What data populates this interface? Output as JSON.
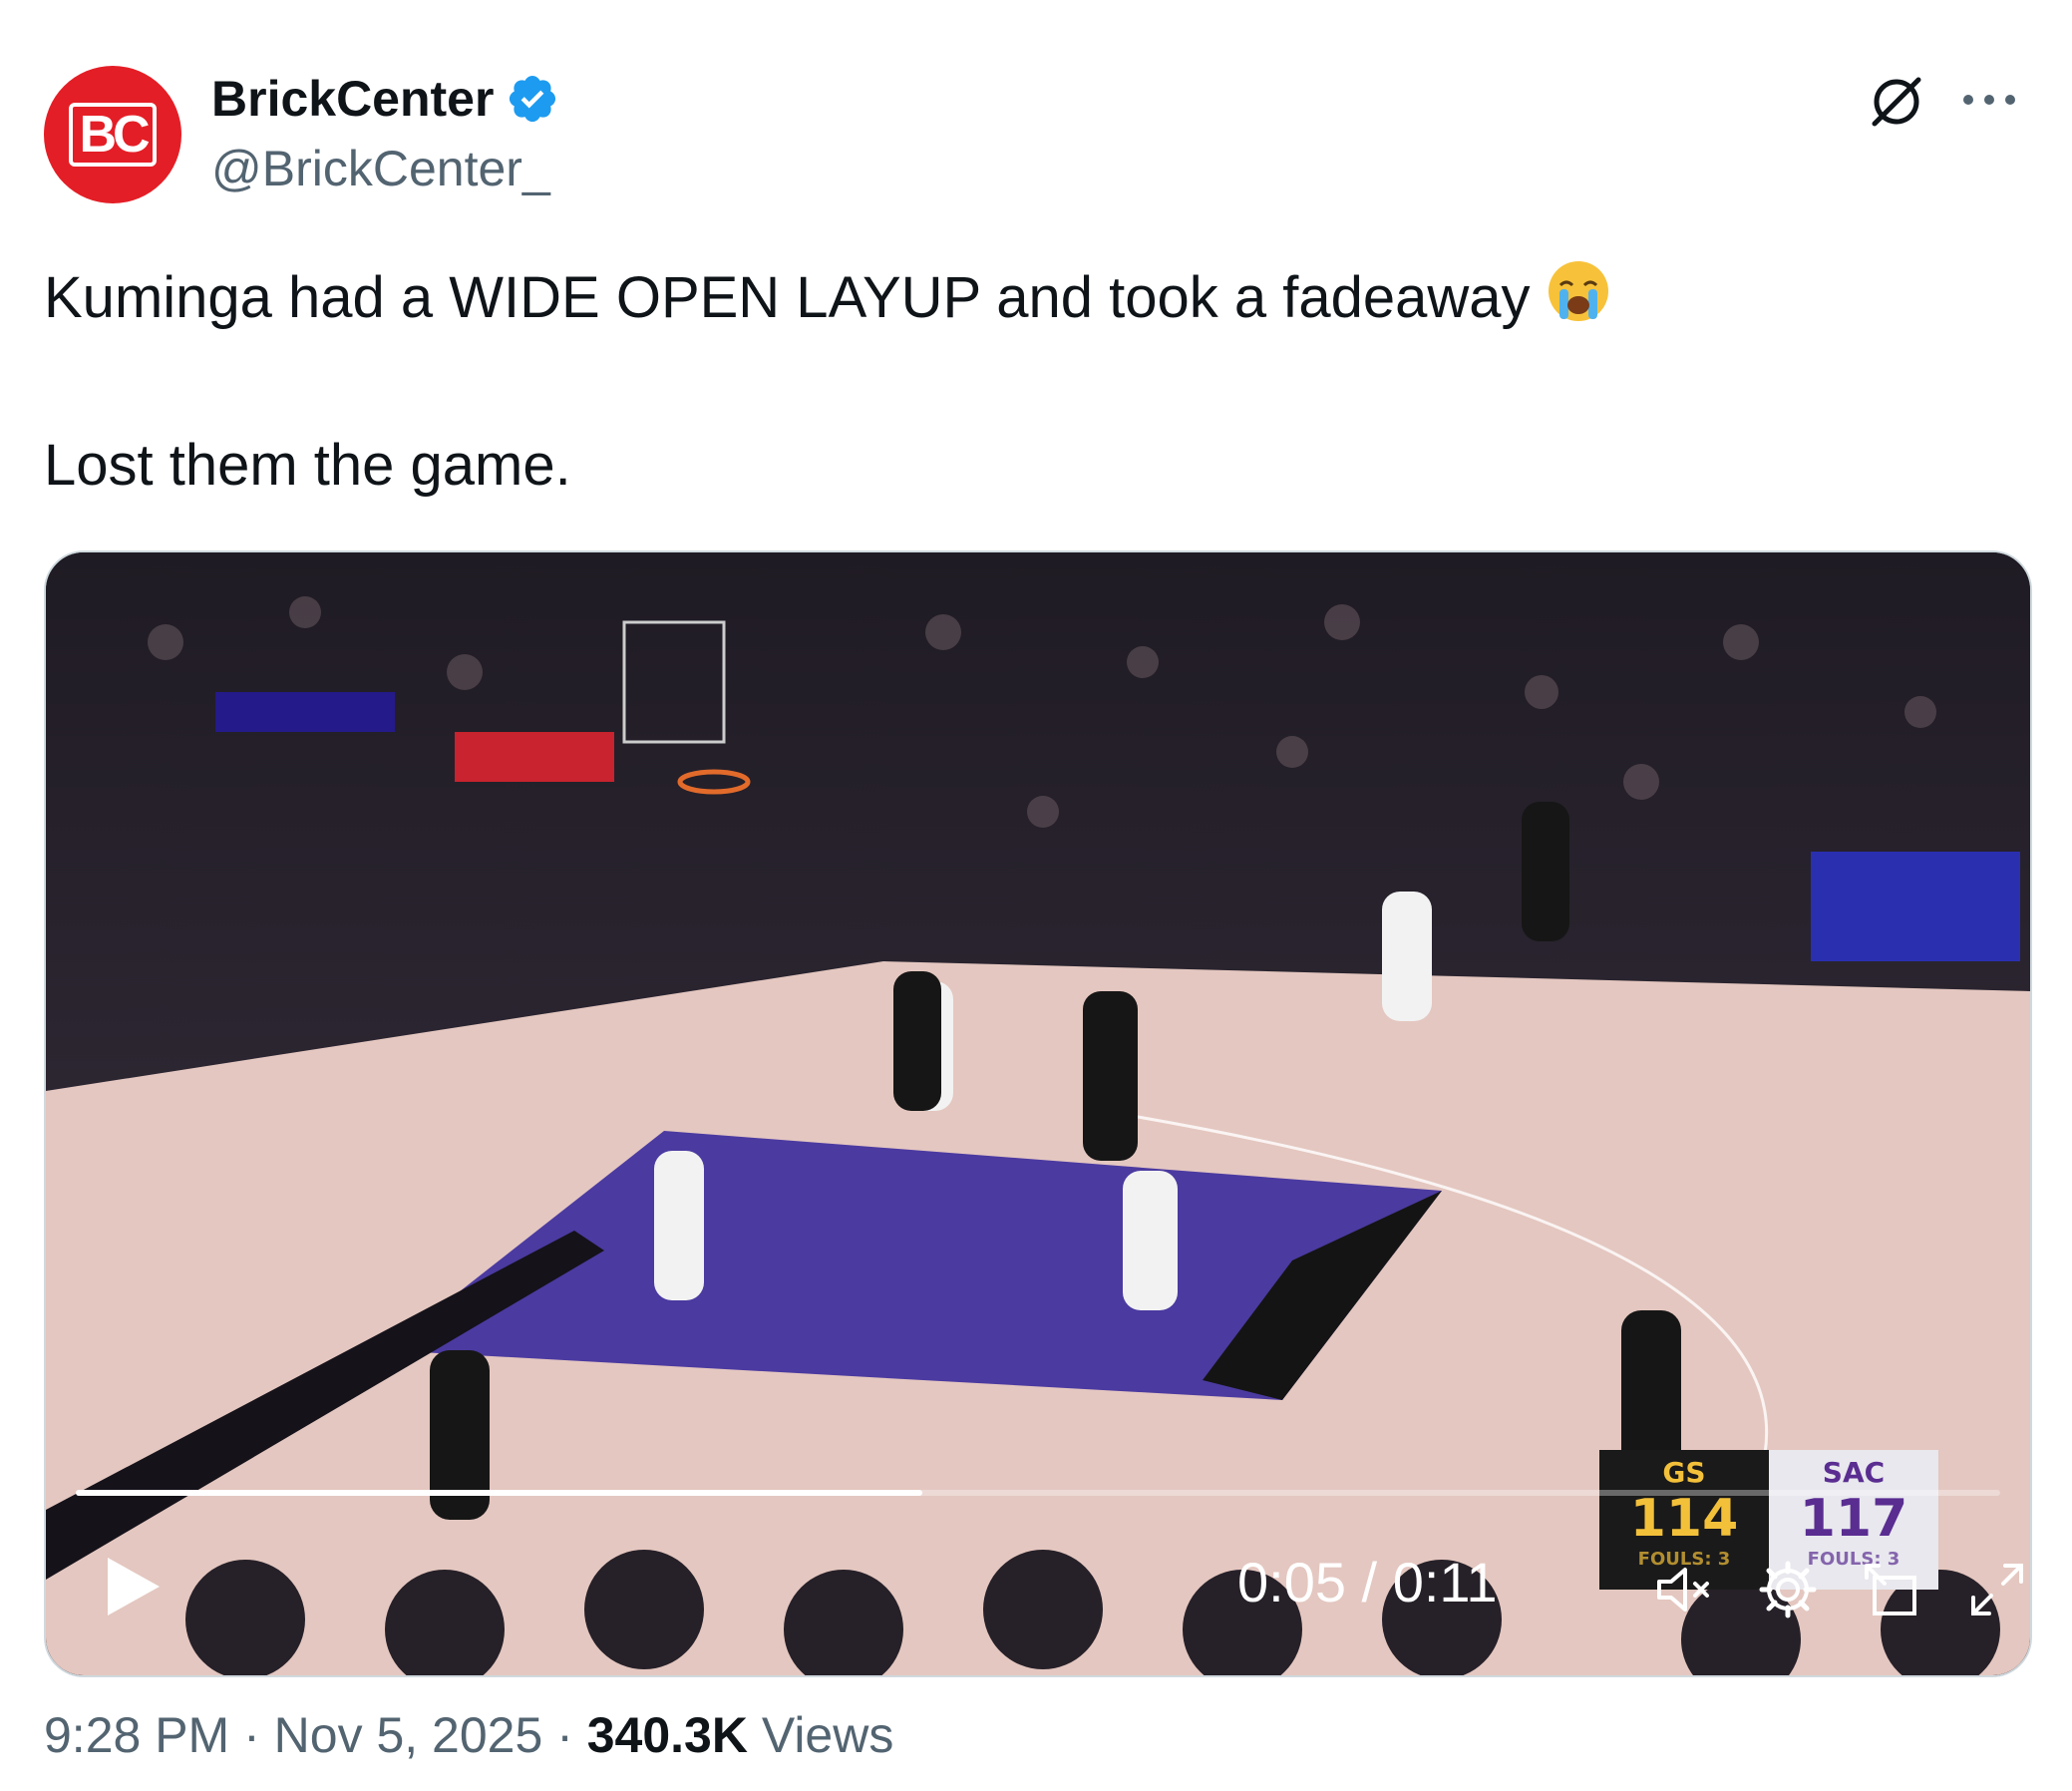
{
  "author": {
    "display_name": "BrickCenter",
    "handle": "@BrickCenter_",
    "avatar_text": "BC",
    "verified": true,
    "avatar_color": "#e41e26",
    "verified_color": "#1d9bf0"
  },
  "tweet": {
    "line1": "Kuminga had a WIDE OPEN LAYUP and took a fadeaway",
    "line1_emoji": "loudly-crying-face-emoji",
    "line2": "Lost them the game."
  },
  "video": {
    "current_time": "0:05",
    "duration": "0:11",
    "progress": 0.44,
    "scoreboard": {
      "home_abbr": "GS",
      "home_score": "114",
      "home_fouls": "FOULS: 3",
      "away_abbr": "SAC",
      "away_score": "117",
      "away_fouls": "FOULS: 3"
    },
    "controls": [
      "play-icon",
      "mute-icon",
      "settings-icon",
      "picture-in-picture-icon",
      "fullscreen-icon"
    ]
  },
  "meta": {
    "time": "9:28 PM",
    "separator": " · ",
    "date": "Nov 5, 2025",
    "views_count": "340.3K",
    "views_label": "Views"
  }
}
